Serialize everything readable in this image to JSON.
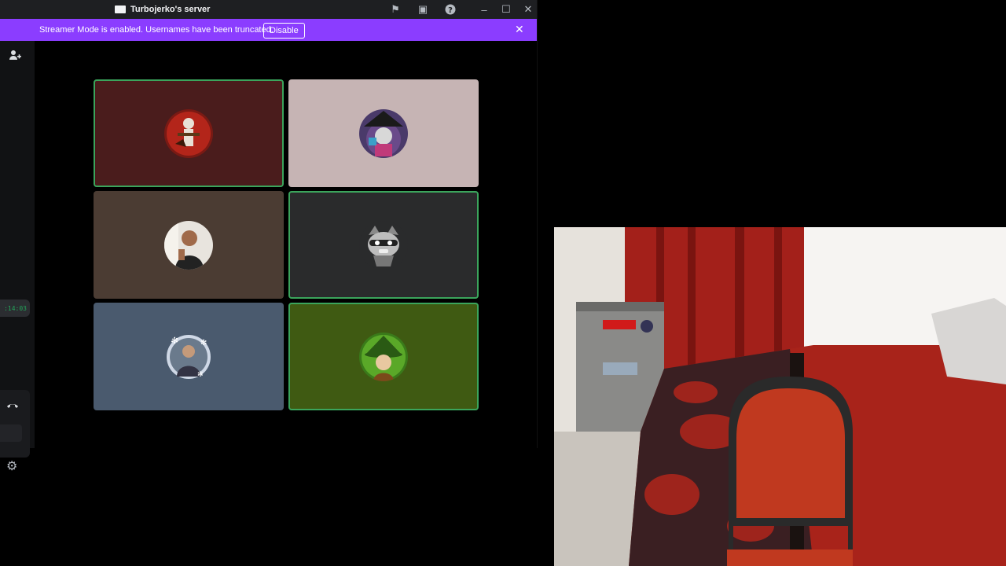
{
  "window": {
    "title": "Turbojerko's server"
  },
  "banner": {
    "text": "Streamer Mode is enabled. Usernames have been truncated.",
    "button_label": "Disable"
  },
  "rail": {
    "timer": ":14:03"
  },
  "tiles": [
    {
      "bg": "#4a1c1c",
      "speaking": true
    },
    {
      "bg": "#c6b4b4",
      "speaking": false
    },
    {
      "bg": "#4b3c33",
      "speaking": false
    },
    {
      "bg": "#2a2b2c",
      "speaking": true
    },
    {
      "bg": "#4a5a6e",
      "speaking": false
    },
    {
      "bg": "#3f5a12",
      "speaking": true
    }
  ],
  "icons": {
    "server": "server-icon",
    "flag": "flag-icon",
    "inbox": "inbox-icon",
    "help": "help-icon",
    "minimize": "minimize-icon",
    "maximize": "maximize-icon",
    "close": "close-icon",
    "add_user": "add-user-icon",
    "hangup": "hangup-icon",
    "settings": "gear-icon"
  },
  "colors": {
    "banner": "#8b3dff",
    "speaking_border": "#3ba55c"
  }
}
